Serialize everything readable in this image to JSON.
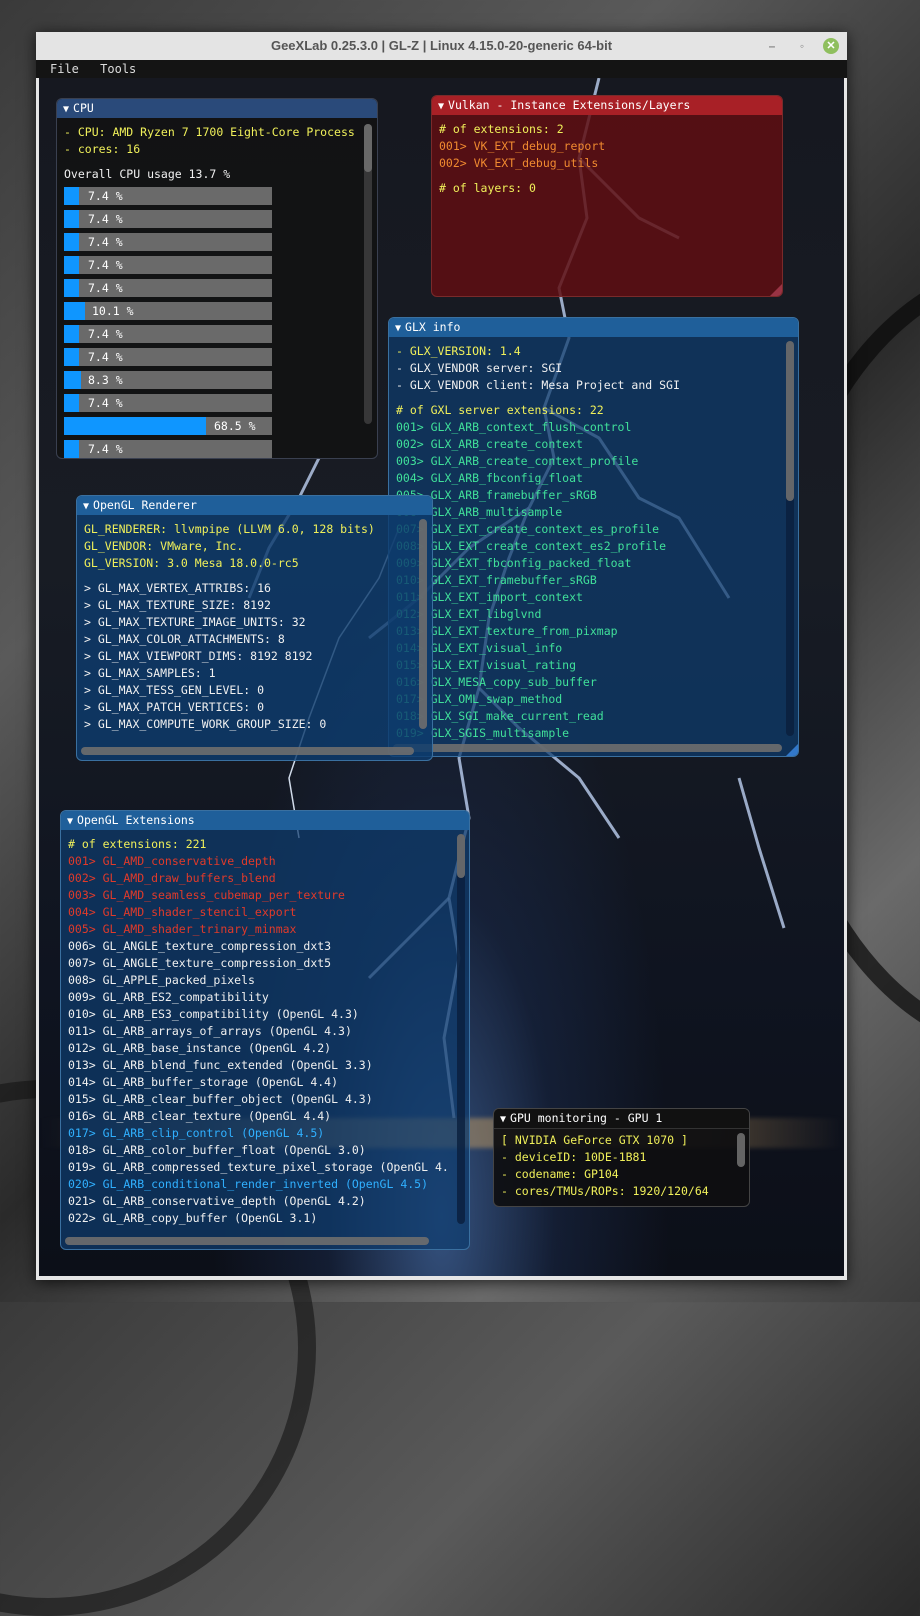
{
  "window": {
    "title": "GeeXLab 0.25.3.0 | GL-Z | Linux 4.15.0-20-generic 64-bit",
    "controls": {
      "minimize": "–",
      "maximize": "◦",
      "close": "✕"
    }
  },
  "menu": [
    "File",
    "Tools"
  ],
  "cpu_panel": {
    "title": "CPU",
    "cpu_line": "- CPU: AMD Ryzen 7 1700 Eight-Core Process",
    "cores_line": "- cores: 16",
    "overall": "Overall CPU usage 13.7 %",
    "cores": [
      {
        "label": "7.4 %",
        "percent": 7.4
      },
      {
        "label": "7.4 %",
        "percent": 7.4
      },
      {
        "label": "7.4 %",
        "percent": 7.4
      },
      {
        "label": "7.4 %",
        "percent": 7.4
      },
      {
        "label": "7.4 %",
        "percent": 7.4
      },
      {
        "label": "10.1 %",
        "percent": 10.1
      },
      {
        "label": "7.4 %",
        "percent": 7.4
      },
      {
        "label": "7.4 %",
        "percent": 7.4
      },
      {
        "label": "8.3 %",
        "percent": 8.3
      },
      {
        "label": "7.4 %",
        "percent": 7.4
      },
      {
        "label": "68.5 %",
        "percent": 68.5
      },
      {
        "label": "7.4 %",
        "percent": 7.4
      }
    ]
  },
  "vulkan_panel": {
    "title": "Vulkan - Instance Extensions/Layers",
    "ext_count": "# of extensions: 2",
    "extensions": [
      "001> VK_EXT_debug_report",
      "002> VK_EXT_debug_utils"
    ],
    "layer_count": "# of layers: 0"
  },
  "glx_panel": {
    "title": "GLX info",
    "version": "- GLX_VERSION: 1.4",
    "vendor_server": "- GLX_VENDOR server: SGI",
    "vendor_client": "- GLX_VENDOR client: Mesa Project and SGI",
    "ext_count": "# of GXL server extensions: 22",
    "extensions": [
      "001> GLX_ARB_context_flush_control",
      "002> GLX_ARB_create_context",
      "003> GLX_ARB_create_context_profile",
      "004> GLX_ARB_fbconfig_float",
      "005> GLX_ARB_framebuffer_sRGB",
      "006> GLX_ARB_multisample",
      "007> GLX_EXT_create_context_es_profile",
      "008> GLX_EXT_create_context_es2_profile",
      "009> GLX_EXT_fbconfig_packed_float",
      "010> GLX_EXT_framebuffer_sRGB",
      "011> GLX_EXT_import_context",
      "012> GLX_EXT_libglvnd",
      "013> GLX_EXT_texture_from_pixmap",
      "014> GLX_EXT_visual_info",
      "015> GLX_EXT_visual_rating",
      "016> GLX_MESA_copy_sub_buffer",
      "017> GLX_OML_swap_method",
      "018> GLX_SGI_make_current_read",
      "019> GLX_SGIS_multisample"
    ]
  },
  "renderer_panel": {
    "title": "OpenGL Renderer",
    "renderer": "GL_RENDERER: llvmpipe (LLVM 6.0, 128 bits)",
    "vendor": "GL_VENDOR: VMware, Inc.",
    "version": "GL_VERSION: 3.0 Mesa 18.0.0-rc5",
    "limits": [
      "> GL_MAX_VERTEX_ATTRIBS: 16",
      "> GL_MAX_TEXTURE_SIZE: 8192",
      "> GL_MAX_TEXTURE_IMAGE_UNITS: 32",
      "> GL_MAX_COLOR_ATTACHMENTS: 8",
      "> GL_MAX_VIEWPORT_DIMS: 8192 8192",
      "> GL_MAX_SAMPLES: 1",
      "> GL_MAX_TESS_GEN_LEVEL: 0",
      "> GL_MAX_PATCH_VERTICES: 0",
      "> GL_MAX_COMPUTE_WORK_GROUP_SIZE: 0"
    ]
  },
  "extensions_panel": {
    "title": "OpenGL Extensions",
    "count": "# of extensions: 221",
    "items": [
      {
        "text": "001> GL_AMD_conservative_depth",
        "kind": "red"
      },
      {
        "text": "002> GL_AMD_draw_buffers_blend",
        "kind": "red"
      },
      {
        "text": "003> GL_AMD_seamless_cubemap_per_texture",
        "kind": "red"
      },
      {
        "text": "004> GL_AMD_shader_stencil_export",
        "kind": "red"
      },
      {
        "text": "005> GL_AMD_shader_trinary_minmax",
        "kind": "red"
      },
      {
        "text": "006> GL_ANGLE_texture_compression_dxt3",
        "kind": "white"
      },
      {
        "text": "007> GL_ANGLE_texture_compression_dxt5",
        "kind": "white"
      },
      {
        "text": "008> GL_APPLE_packed_pixels",
        "kind": "white"
      },
      {
        "text": "009> GL_ARB_ES2_compatibility",
        "kind": "white"
      },
      {
        "text": "010> GL_ARB_ES3_compatibility (OpenGL 4.3)",
        "kind": "white"
      },
      {
        "text": "011> GL_ARB_arrays_of_arrays (OpenGL 4.3)",
        "kind": "white"
      },
      {
        "text": "012> GL_ARB_base_instance (OpenGL 4.2)",
        "kind": "white"
      },
      {
        "text": "013> GL_ARB_blend_func_extended (OpenGL 3.3)",
        "kind": "white"
      },
      {
        "text": "014> GL_ARB_buffer_storage (OpenGL 4.4)",
        "kind": "white"
      },
      {
        "text": "015> GL_ARB_clear_buffer_object (OpenGL 4.3)",
        "kind": "white"
      },
      {
        "text": "016> GL_ARB_clear_texture (OpenGL 4.4)",
        "kind": "white"
      },
      {
        "text": "017> GL_ARB_clip_control (OpenGL 4.5)",
        "kind": "blue"
      },
      {
        "text": "018> GL_ARB_color_buffer_float (OpenGL 3.0)",
        "kind": "white"
      },
      {
        "text": "019> GL_ARB_compressed_texture_pixel_storage (OpenGL 4.",
        "kind": "white"
      },
      {
        "text": "020> GL_ARB_conditional_render_inverted (OpenGL 4.5)",
        "kind": "blue"
      },
      {
        "text": "021> GL_ARB_conservative_depth (OpenGL 4.2)",
        "kind": "white"
      },
      {
        "text": "022> GL_ARB_copy_buffer (OpenGL 3.1)",
        "kind": "white"
      }
    ]
  },
  "gpu_panel": {
    "title": "GPU monitoring - GPU 1",
    "name": "[ NVIDIA GeForce GTX 1070 ]",
    "device_id": "- deviceID: 10DE-1B81",
    "codename": "- codename: GP104",
    "units": "- cores/TMUs/ROPs: 1920/120/64"
  }
}
